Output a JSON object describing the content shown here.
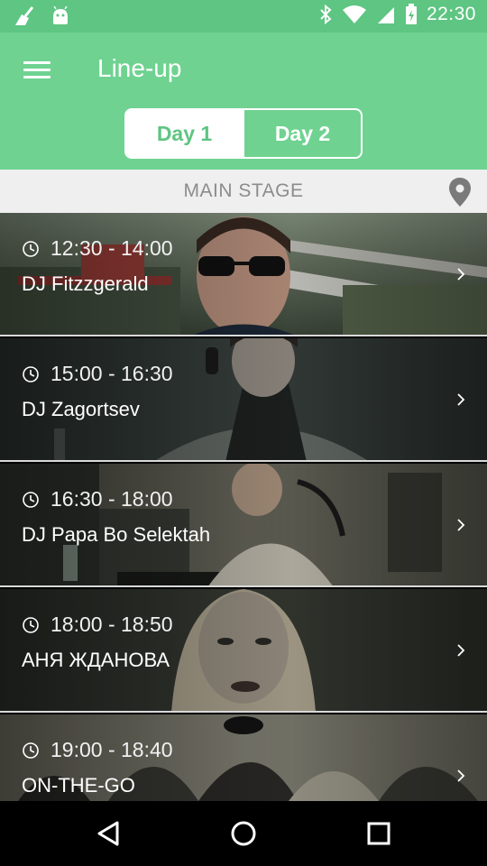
{
  "status_bar": {
    "time": "22:30",
    "left_icons": [
      "broom-icon",
      "android-icon"
    ],
    "right_icons": [
      "bluetooth-icon",
      "wifi-icon",
      "signal-icon",
      "battery-icon"
    ]
  },
  "app_bar": {
    "title": "Line-up",
    "menu_icon": "hamburger-menu-icon",
    "tabs": [
      {
        "label": "Day 1",
        "selected": true
      },
      {
        "label": "Day 2",
        "selected": false
      }
    ]
  },
  "stage": {
    "name": "MAIN STAGE",
    "icon": "location-pin-icon"
  },
  "lineup": [
    {
      "time": "12:30 - 14:00",
      "artist": "DJ Fitzzgerald"
    },
    {
      "time": "15:00 - 16:30",
      "artist": "DJ Zagortsev"
    },
    {
      "time": "16:30 - 18:00",
      "artist": "DJ Papa Bo Selektah"
    },
    {
      "time": "18:00 - 18:50",
      "artist": "АНЯ ЖДАНОВА"
    },
    {
      "time": "19:00 - 18:40",
      "artist": "ON-THE-GO"
    }
  ],
  "nav_bar": {
    "icons": [
      "back-icon",
      "home-icon",
      "recents-icon"
    ]
  },
  "colors": {
    "status_bar": "#5ec582",
    "app_bar": "#6fd291",
    "accent": "#5ec582",
    "stage_bar": "#efefef"
  }
}
